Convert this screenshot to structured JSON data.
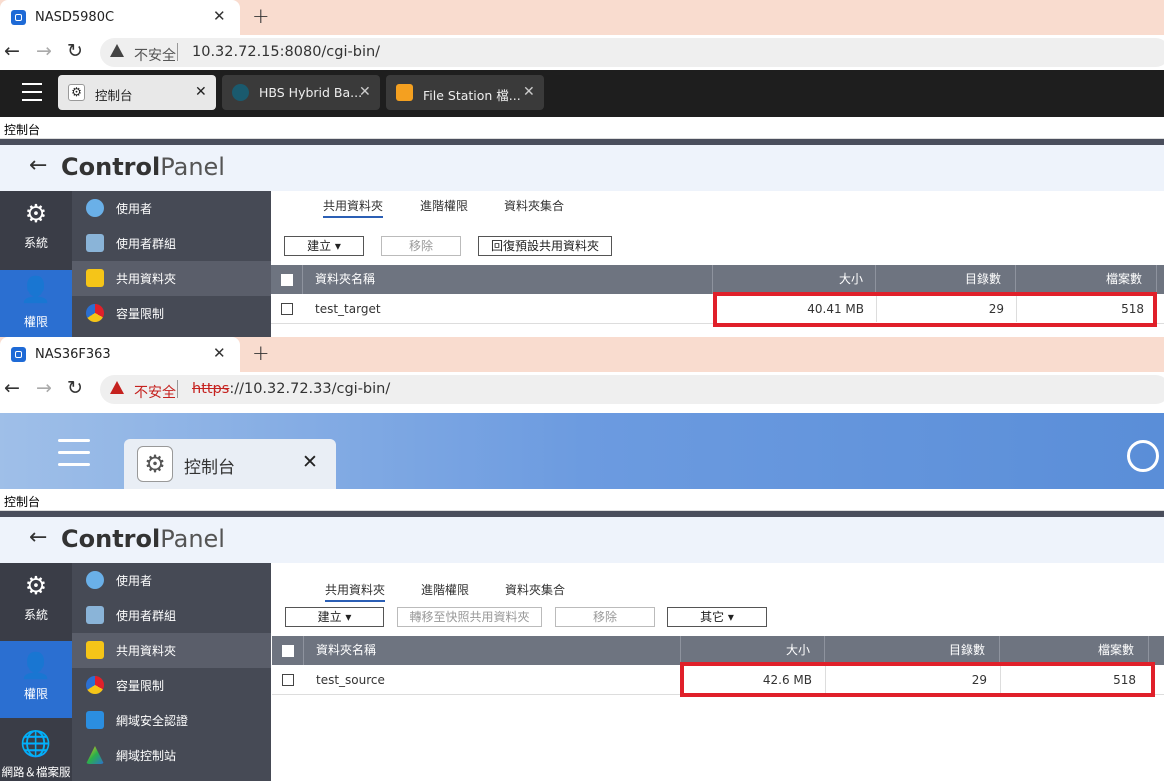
{
  "window1": {
    "browser_tab_title": "NASD5980C",
    "security_label": "不安全",
    "url": "10.32.72.15:8080/cgi-bin/",
    "app_tabs": [
      {
        "label": "控制台"
      },
      {
        "label": "HBS Hybrid Ba..."
      },
      {
        "label": "File Station 檔..."
      }
    ],
    "title_strip": "控制台",
    "header": {
      "bold": "Control",
      "light": "Panel"
    },
    "left_nav": [
      {
        "label": "系統",
        "icon": "gear-icon"
      },
      {
        "label": "權限",
        "icon": "user-icon"
      }
    ],
    "sub_nav": [
      {
        "label": "使用者"
      },
      {
        "label": "使用者群組"
      },
      {
        "label": "共用資料夾"
      },
      {
        "label": "容量限制"
      }
    ],
    "content_tabs": [
      "共用資料夾",
      "進階權限",
      "資料夾集合"
    ],
    "toolbar": {
      "create": "建立",
      "remove": "移除",
      "restore": "回復預設共用資料夾"
    },
    "columns": [
      "資料夾名稱",
      "大小",
      "目錄數",
      "檔案數"
    ],
    "rows": [
      {
        "name": "test_target",
        "size": "40.41 MB",
        "dirs": "29",
        "files": "518"
      }
    ]
  },
  "window2": {
    "browser_tab_title": "NAS36F363",
    "security_label": "不安全",
    "url_scheme": "https",
    "url_rest": "://10.32.72.33/cgi-bin/",
    "app_tab": {
      "label": "控制台"
    },
    "title_strip": "控制台",
    "header": {
      "bold": "Control",
      "light": "Panel"
    },
    "left_nav": [
      {
        "label": "系統",
        "icon": "gear-icon"
      },
      {
        "label": "權限",
        "icon": "user-icon"
      },
      {
        "label": "網路＆檔案服務",
        "icon": "globe-icon"
      }
    ],
    "sub_nav": [
      {
        "label": "使用者"
      },
      {
        "label": "使用者群組"
      },
      {
        "label": "共用資料夾"
      },
      {
        "label": "容量限制"
      },
      {
        "label": "網域安全認證"
      },
      {
        "label": "網域控制站"
      }
    ],
    "content_tabs": [
      "共用資料夾",
      "進階權限",
      "資料夾集合"
    ],
    "toolbar": {
      "create": "建立",
      "convert": "轉移至快照共用資料夾",
      "remove": "移除",
      "other": "其它"
    },
    "columns": [
      "資料夾名稱",
      "大小",
      "目錄數",
      "檔案數"
    ],
    "rows": [
      {
        "name": "test_source",
        "size": "42.6 MB",
        "dirs": "29",
        "files": "518"
      }
    ]
  },
  "colors": {
    "highlight": "#e0202a",
    "accent": "#2b6fd1",
    "tabstrip": "#f9dccf"
  }
}
